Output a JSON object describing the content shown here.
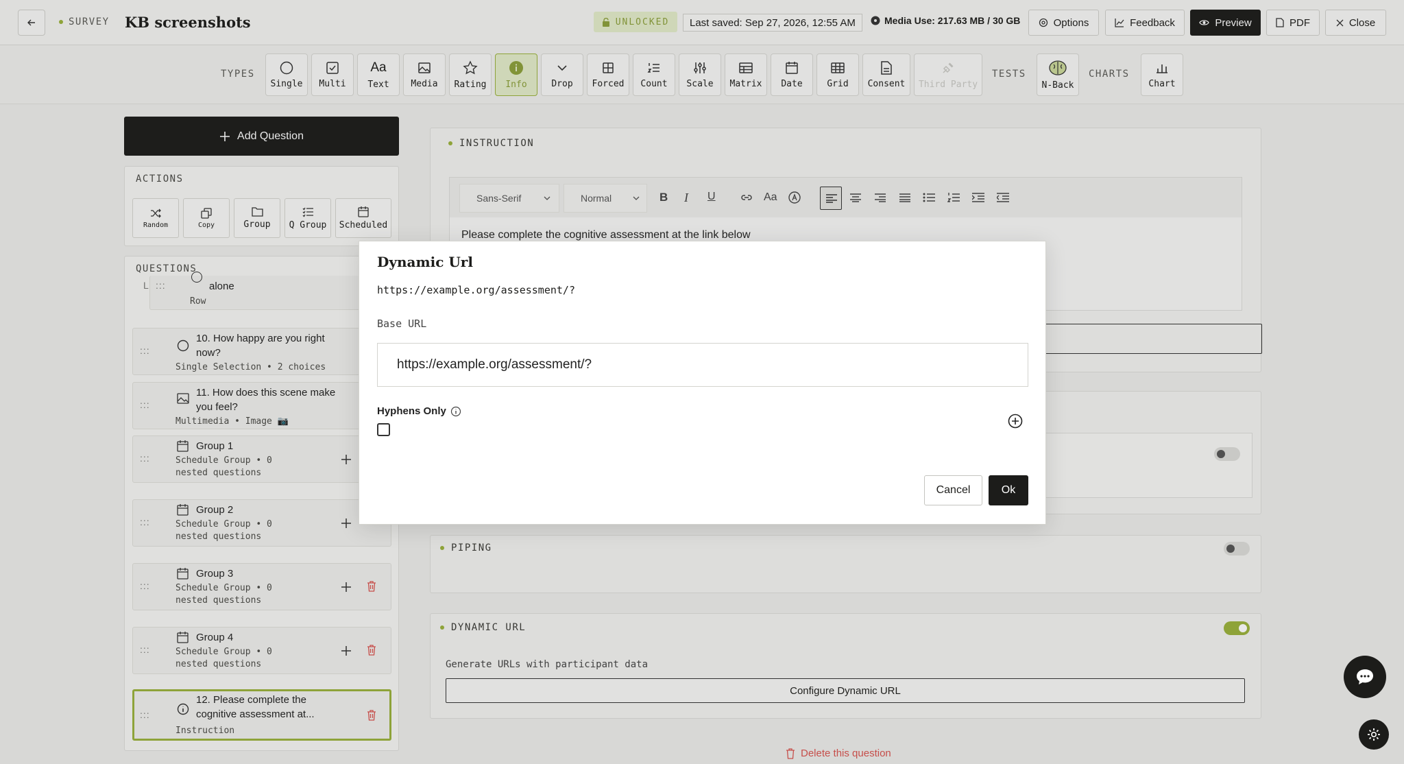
{
  "header": {
    "survey_tag": "SURVEY",
    "title": "KB screenshots",
    "unlocked": "UNLOCKED",
    "last_saved": "Last saved: Sep 27, 2026, 12:55 AM",
    "media_use": "Media Use: 217.63 MB / 30 GB",
    "options": "Options",
    "feedback": "Feedback",
    "preview": "Preview",
    "pdf": "PDF",
    "close": "Close"
  },
  "toolbar": {
    "types_label": "TYPES",
    "tests_label": "TESTS",
    "charts_label": "CHARTS",
    "types": [
      "Single",
      "Multi",
      "Text",
      "Media",
      "Rating",
      "Info",
      "Drop",
      "Forced",
      "Count",
      "Scale",
      "Matrix",
      "Date",
      "Grid",
      "Consent",
      "Third Party"
    ],
    "tests": [
      "N-Back"
    ],
    "charts": [
      "Chart"
    ],
    "active": "Info"
  },
  "left": {
    "add_question": "Add Question",
    "actions_label": "ACTIONS",
    "actions": [
      "Random",
      "Copy",
      "Group",
      "Q Group",
      "Scheduled"
    ],
    "questions_label": "QUESTIONS",
    "partial_item": {
      "title": "alone",
      "sub": "Row"
    },
    "questions": [
      {
        "title": "10. How happy are you right now?",
        "sub": "Single Selection • 2 choices"
      },
      {
        "title": "11. How does this scene make you feel?",
        "sub": "Multimedia • Image 📷"
      },
      {
        "title": "Group 1",
        "sub": "Schedule Group • 0 nested questions"
      },
      {
        "title": "Group 2",
        "sub": "Schedule Group • 0 nested questions"
      },
      {
        "title": "Group 3",
        "sub": "Schedule Group • 0 nested questions"
      },
      {
        "title": "Group 4",
        "sub": "Schedule Group • 0 nested questions"
      },
      {
        "title": "12. Please complete the cognitive assessment at...",
        "sub": "Instruction"
      }
    ]
  },
  "editor": {
    "instruction_label": "INSTRUCTION",
    "font": "Sans-Serif",
    "size": "Normal",
    "body": "Please complete the cognitive assessment at the link below",
    "piping_label": "PIPING",
    "dynamic_url_label": "DYNAMIC URL",
    "dynamic_url_desc": "Generate URLs with participant data",
    "configure_button": "Configure Dynamic URL",
    "delete_link": "Delete this question"
  },
  "modal": {
    "title": "Dynamic Url",
    "preview": "https://example.org/assessment/?",
    "base_url_label": "Base URL",
    "base_url_value": "https://example.org/assessment/?",
    "hyphens_label": "Hyphens Only",
    "cancel": "Cancel",
    "ok": "Ok"
  },
  "colors": {
    "accent": "#9ab23c",
    "dark": "#1c1c1a",
    "background": "#ececea"
  }
}
